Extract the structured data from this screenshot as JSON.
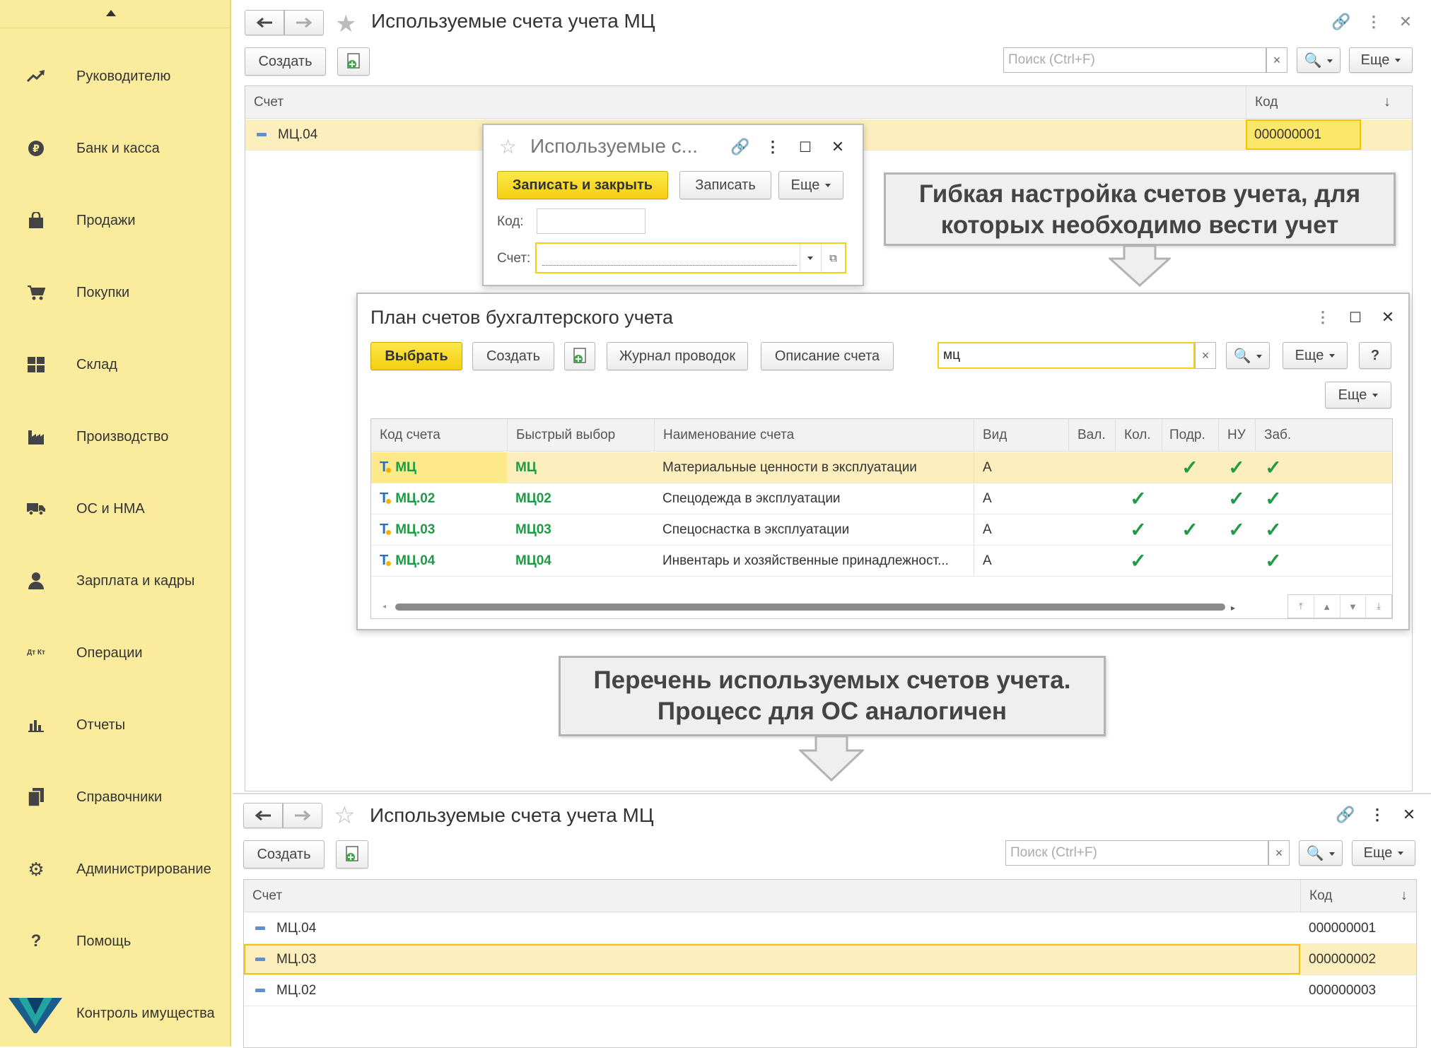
{
  "sidebar": {
    "items": [
      {
        "label": "Руководителю",
        "icon": "trend-chart-icon"
      },
      {
        "label": "Банк и касса",
        "icon": "coin-icon"
      },
      {
        "label": "Продажи",
        "icon": "shopping-bag-icon"
      },
      {
        "label": "Покупки",
        "icon": "shopping-cart-icon"
      },
      {
        "label": "Склад",
        "icon": "warehouse-grid-icon"
      },
      {
        "label": "Производство",
        "icon": "factory-icon"
      },
      {
        "label": "ОС и НМА",
        "icon": "truck-icon"
      },
      {
        "label": "Зарплата и кадры",
        "icon": "person-icon"
      },
      {
        "label": "Операции",
        "icon": "dt-kt-icon"
      },
      {
        "label": "Отчеты",
        "icon": "bar-chart-icon"
      },
      {
        "label": "Справочники",
        "icon": "books-icon"
      },
      {
        "label": "Администрирование",
        "icon": "gear-icon"
      },
      {
        "label": "Помощь",
        "icon": "question-icon"
      },
      {
        "label": "Контроль имущества",
        "icon": "brand-logo-icon"
      }
    ],
    "dt_kt_text": "Дт Кт",
    "help_glyph": "?"
  },
  "top_form": {
    "title": "Используемые счета учета МЦ",
    "create_label": "Создать",
    "search_placeholder": "Поиск (Ctrl+F)",
    "more_label": "Еще",
    "col_account": "Счет",
    "col_code": "Код",
    "rows": [
      {
        "account": "МЦ.04",
        "code": "000000001"
      }
    ]
  },
  "edit_dialog": {
    "title": "Используемые с...",
    "save_close_label": "Записать и закрыть",
    "save_label": "Записать",
    "more_label": "Еще",
    "code_label": "Код:",
    "account_label": "Счет:"
  },
  "callout_top": "Гибкая настройка счетов учета, для которых необходимо вести учет",
  "callout_bottom": "Перечень используемых счетов учета. Процесс для ОС аналогичен",
  "plan_dialog": {
    "title": "План счетов бухгалтерского учета",
    "select_label": "Выбрать",
    "create_label": "Создать",
    "journal_label": "Журнал проводок",
    "description_label": "Описание счета",
    "search_value": "мц",
    "more_label": "Еще",
    "help_label": "?",
    "columns": [
      "Код счета",
      "Быстрый выбор",
      "Наименование счета",
      "Вид",
      "Вал.",
      "Кол.",
      "Подр.",
      "НУ",
      "Заб."
    ],
    "rows": [
      {
        "code": "МЦ",
        "quick": "МЦ",
        "name": "Материальные ценности в эксплуатации",
        "kind": "А",
        "val": false,
        "kol": false,
        "podr": true,
        "nu": true,
        "zab": true
      },
      {
        "code": "МЦ.02",
        "quick": "МЦ02",
        "name": "Спецодежда в эксплуатации",
        "kind": "А",
        "val": false,
        "kol": true,
        "podr": false,
        "nu": true,
        "zab": true
      },
      {
        "code": "МЦ.03",
        "quick": "МЦ03",
        "name": "Спецоснастка в эксплуатации",
        "kind": "А",
        "val": false,
        "kol": true,
        "podr": true,
        "nu": true,
        "zab": true
      },
      {
        "code": "МЦ.04",
        "quick": "МЦ04",
        "name": "Инвентарь и хозяйственные принадлежност...",
        "kind": "А",
        "val": false,
        "kol": true,
        "podr": false,
        "nu": false,
        "zab": true
      }
    ],
    "check_glyph": "✓"
  },
  "bottom_form": {
    "title": "Используемые счета учета МЦ",
    "create_label": "Создать",
    "search_placeholder": "Поиск (Ctrl+F)",
    "more_label": "Еще",
    "col_account": "Счет",
    "col_code": "Код",
    "rows": [
      {
        "account": "МЦ.04",
        "code": "000000001"
      },
      {
        "account": "МЦ.03",
        "code": "000000002"
      },
      {
        "account": "МЦ.02",
        "code": "000000003"
      }
    ]
  },
  "colors": {
    "sidebar": "#fbec9d",
    "accent_yellow": "#f4cf12",
    "selection": "#fcefbd",
    "check_green": "#1f9a45",
    "account_green": "#1f9a45"
  }
}
